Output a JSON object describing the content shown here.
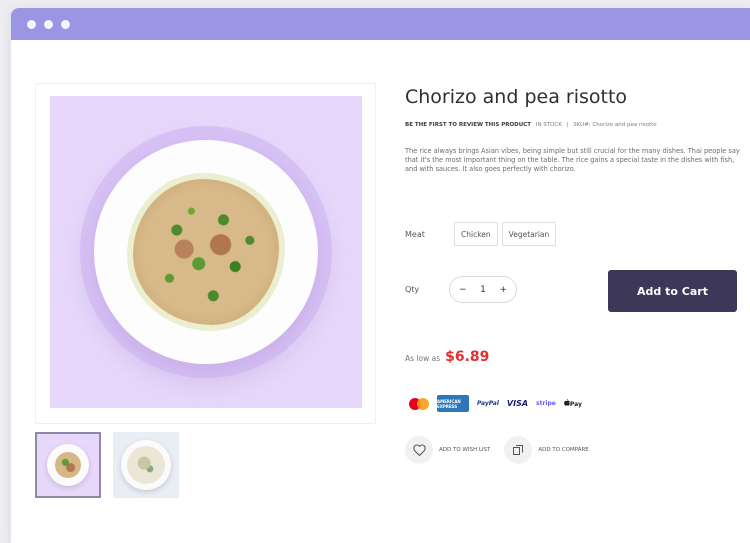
{
  "product": {
    "title": "Chorizo and pea risotto",
    "review_link": "BE THE FIRST TO REVIEW THIS PRODUCT",
    "stock_status": "IN STOCK",
    "separator": "|",
    "sku_label": "SKU#:",
    "sku_value": "Chorizo and pea risotto",
    "description": "The rice always brings Asian vibes, being simple but still crucial for the many dishes. Thai people say that it's the most important thing on the table. The rice gains a special taste in the dishes with fish, and with sauces. It also goes perfectly with chorizo."
  },
  "options": {
    "label": "Meat",
    "choices": [
      "Chicken",
      "Vegetarian"
    ]
  },
  "quantity": {
    "label": "Qty",
    "value": "1",
    "minus": "−",
    "plus": "+"
  },
  "cart": {
    "button_label": "Add to Cart"
  },
  "price": {
    "prefix": "As low as",
    "amount": "$6.89"
  },
  "payments": {
    "amex": "AMERICAN EXPRESS",
    "paypal": "PayPal",
    "visa": "VISA",
    "stripe": "stripe",
    "applepay": "Pay"
  },
  "actions": {
    "wishlist": "ADD TO WISH LIST",
    "compare": "ADD TO COMPARE"
  },
  "colors": {
    "titlebar": "#9b96e3",
    "image_bg": "#e7d8fb",
    "cart_button": "#3d3858",
    "price": "#e0312f"
  },
  "icons": [
    "heart-icon",
    "compare-icon",
    "mastercard-icon",
    "apple-icon"
  ]
}
